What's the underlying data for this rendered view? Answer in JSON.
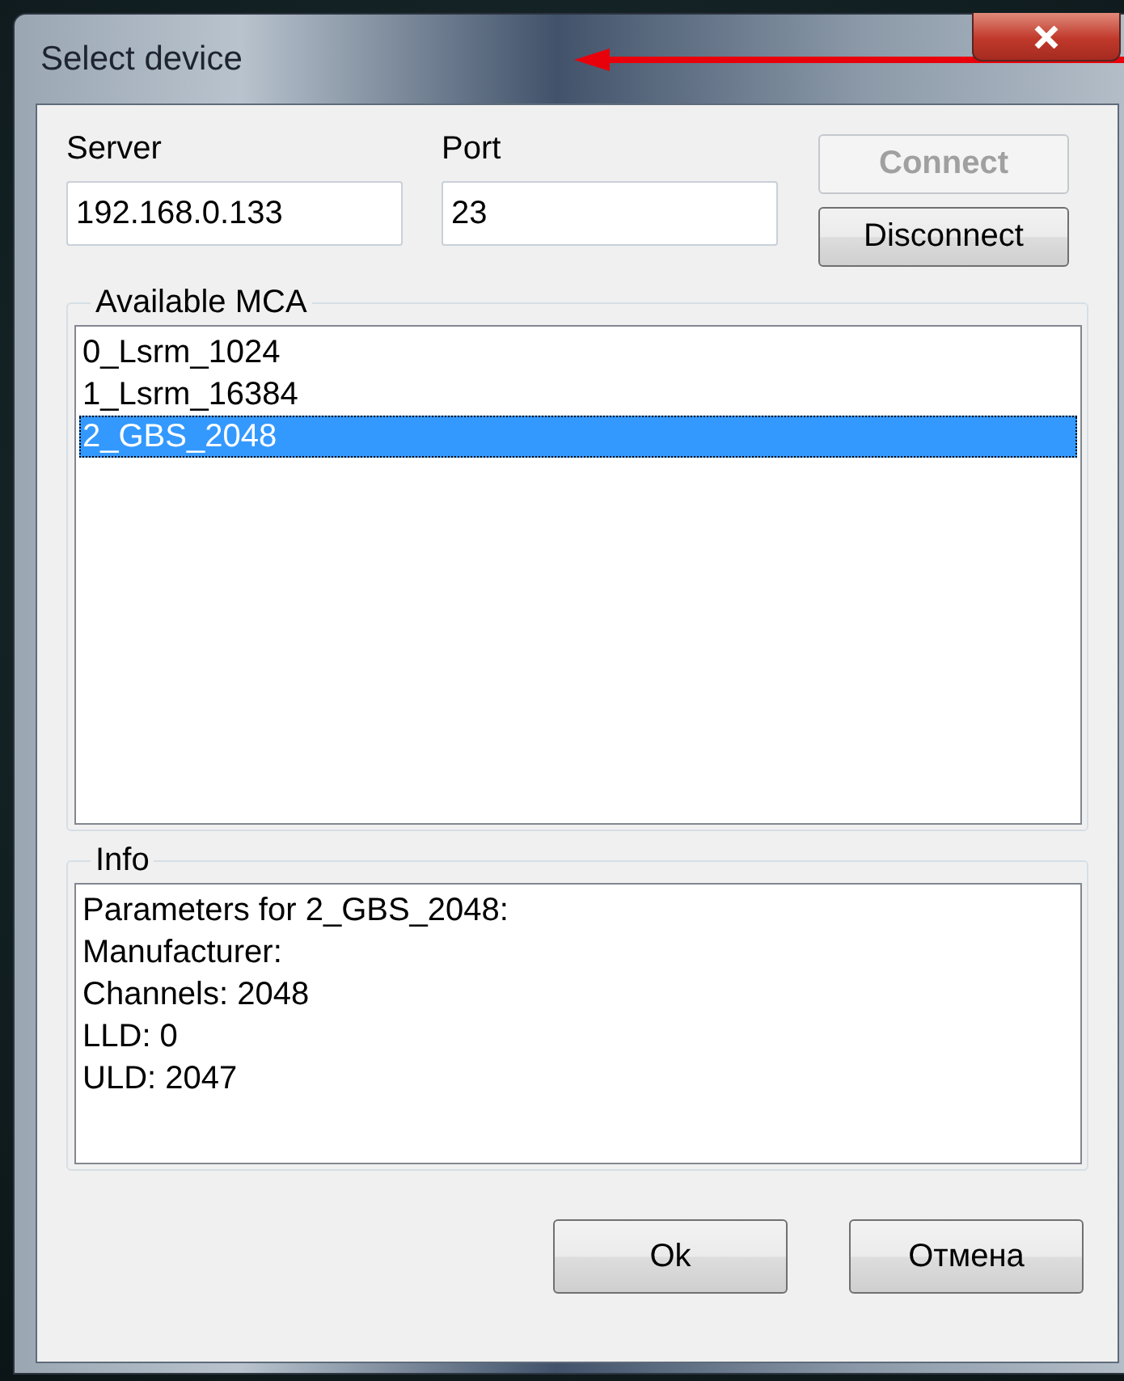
{
  "window": {
    "title": "Select device"
  },
  "server": {
    "label": "Server",
    "value": "192.168.0.133"
  },
  "port": {
    "label": "Port",
    "value": "23"
  },
  "buttons": [
    {
      "label": "Connect",
      "disabled": true
    },
    {
      "label": "Disconnect",
      "disabled": false
    }
  ],
  "available_mca": {
    "title": "Available MCA",
    "items": [
      {
        "label": "0_Lsrm_1024",
        "selected": false
      },
      {
        "label": "1_Lsrm_16384",
        "selected": false
      },
      {
        "label": "2_GBS_2048",
        "selected": true
      }
    ]
  },
  "info": {
    "title": "Info",
    "lines": [
      "Parameters for 2_GBS_2048:",
      "Manufacturer:",
      "Channels: 2048",
      "LLD: 0",
      "ULD: 2047"
    ]
  },
  "footer_buttons": [
    "Ok",
    "Отмена"
  ]
}
